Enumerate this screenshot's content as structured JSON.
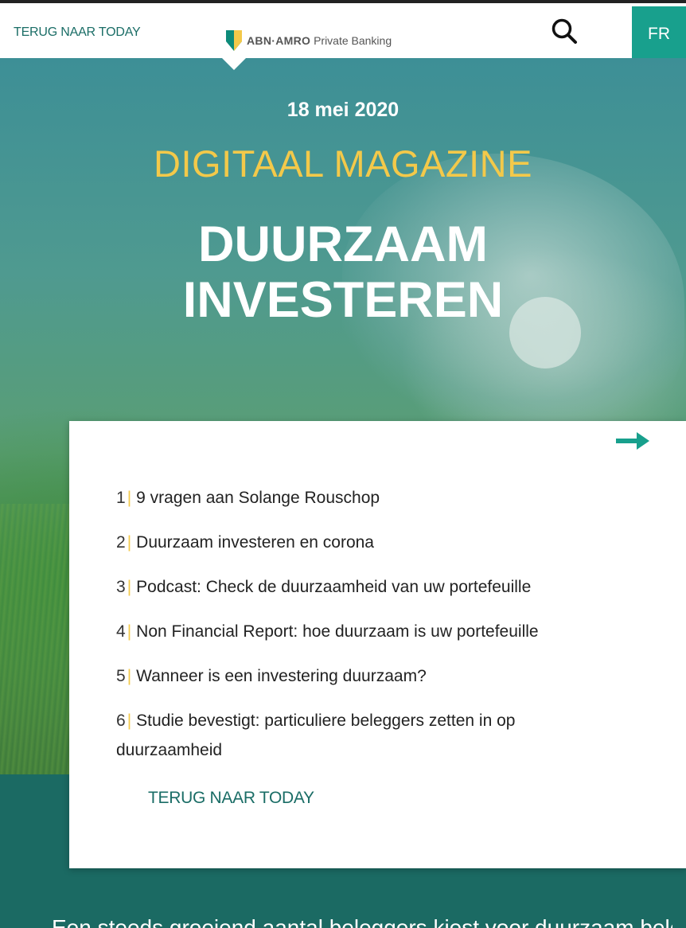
{
  "header": {
    "back_link": "TERUG NAAR TODAY",
    "logo_brand": "ABN·AMRO",
    "logo_suffix": "Private Banking",
    "language": "FR"
  },
  "hero": {
    "date": "18 mei 2020",
    "magazine": "DIGITAAL MAGAZINE",
    "title_line1": "DUURZAAM",
    "title_line2": "INVESTEREN"
  },
  "toc": {
    "items": [
      {
        "num": "1",
        "label": "9 vragen aan Solange Rouschop"
      },
      {
        "num": "2",
        "label": "Duurzaam investeren en corona"
      },
      {
        "num": "3",
        "label": "Podcast: Check de duurzaamheid van uw portefeuille"
      },
      {
        "num": "4",
        "label": "Non Financial Report: hoe duurzaam is uw portefeuille"
      },
      {
        "num": "5",
        "label": "Wanneer is een investering duurzaam?"
      },
      {
        "num": "6",
        "label": "Studie bevestigt: particuliere beleggers zetten in op duurzaamheid"
      }
    ],
    "back_link": "TERUG NAAR TODAY"
  },
  "footer": {
    "text": "Een steeds groeiend aantal beleggers kiest voor duurzaam beleggen"
  },
  "colors": {
    "accent_teal": "#18a08d",
    "dark_teal": "#1a6d66",
    "yellow": "#f3c94a"
  }
}
